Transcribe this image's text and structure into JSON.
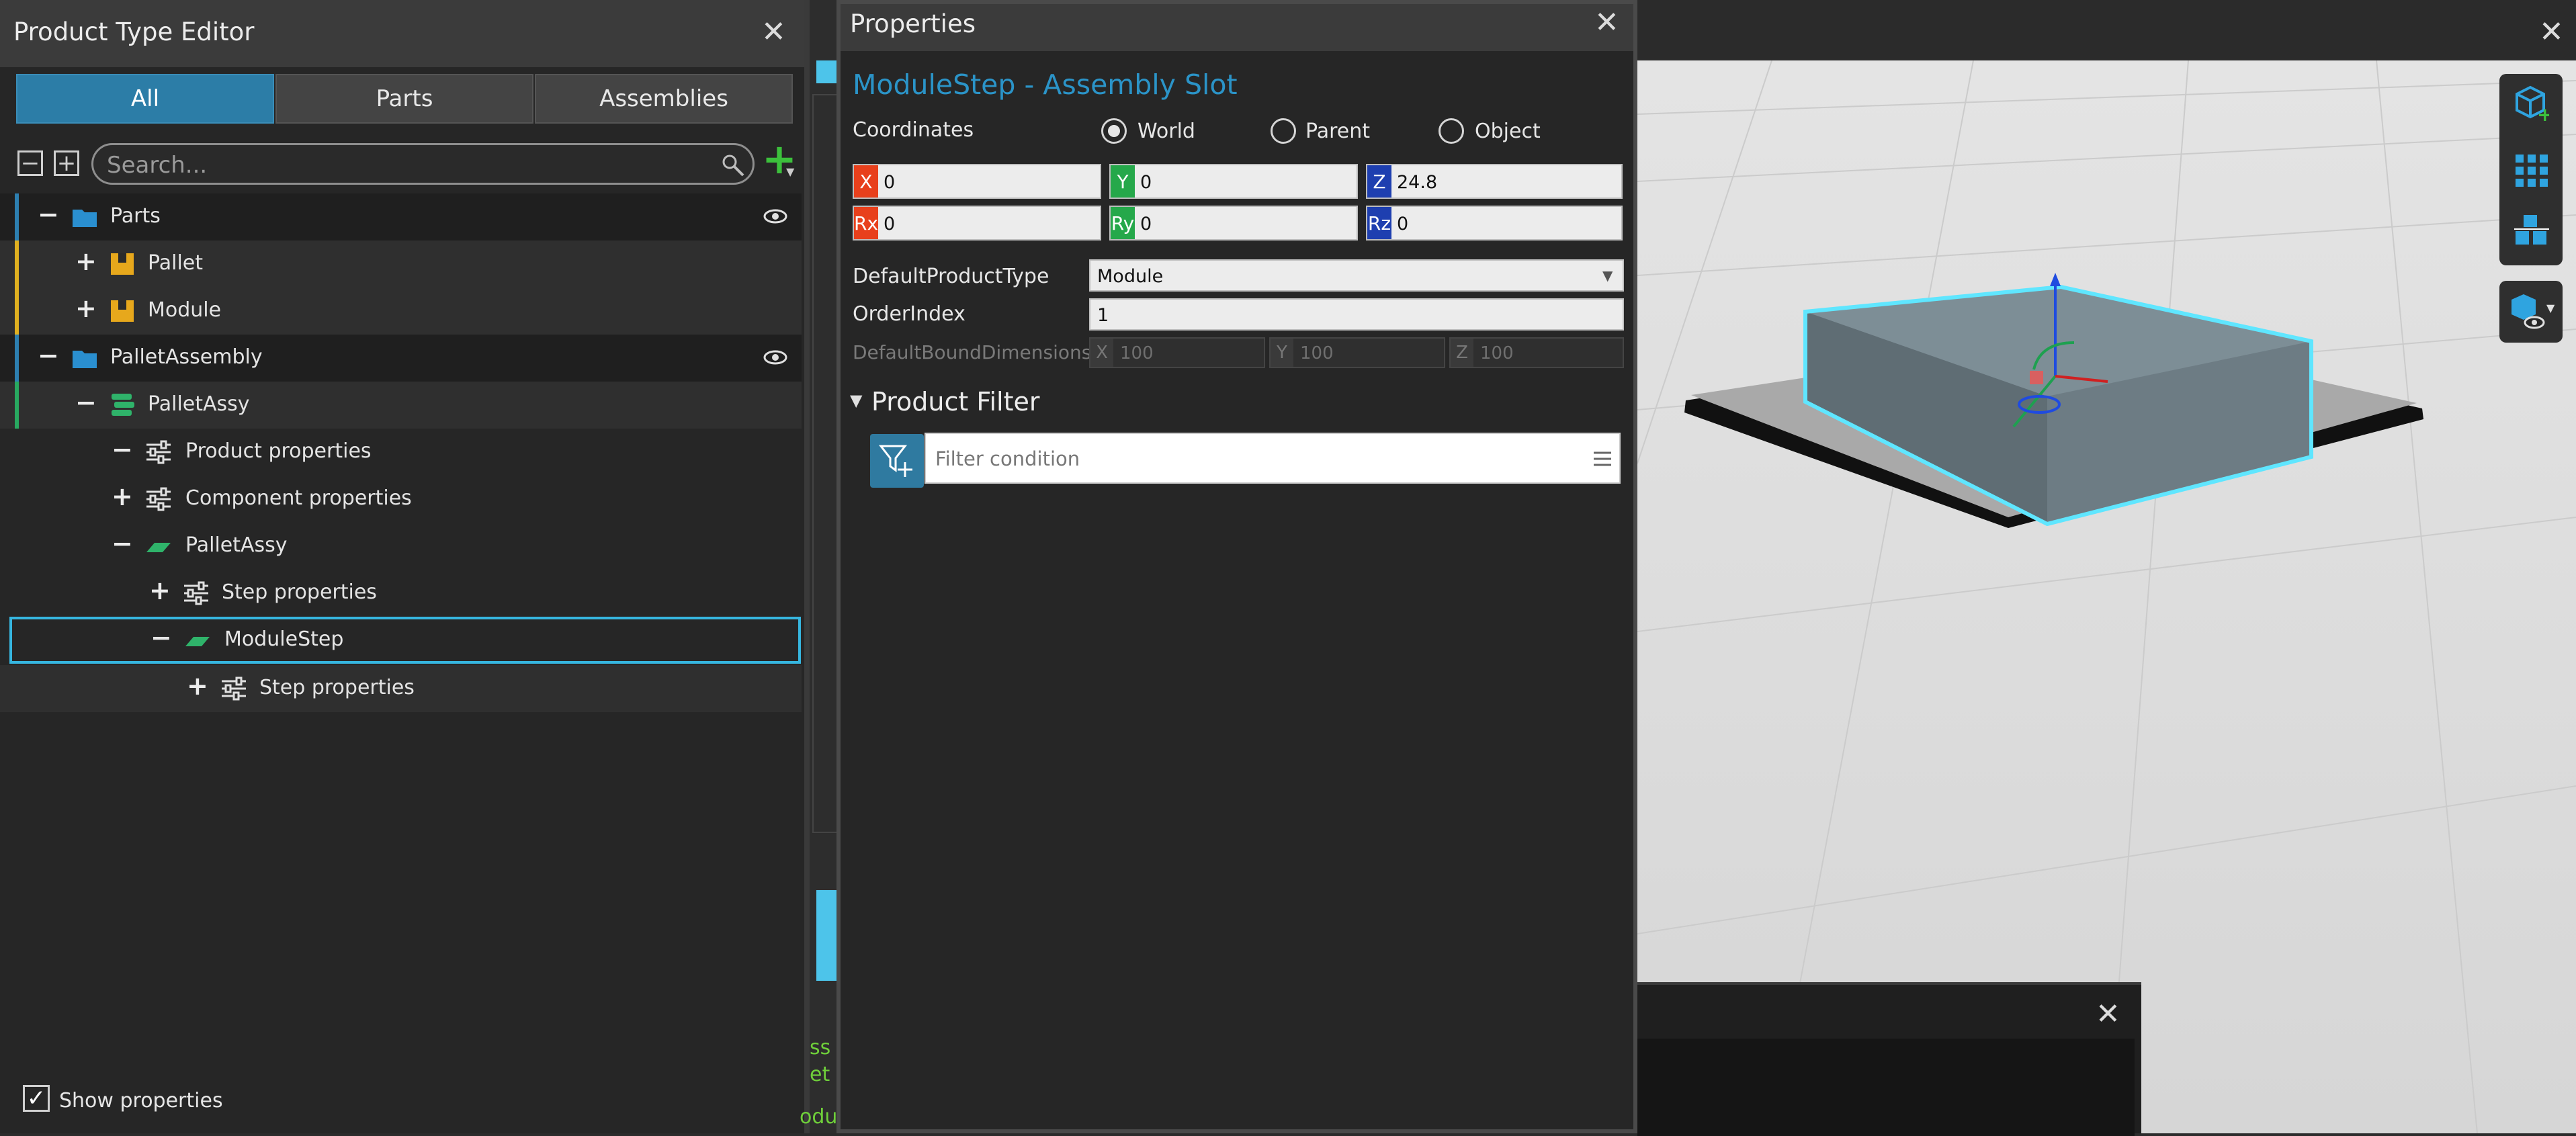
{
  "product_type_editor": {
    "title": "Product Type Editor",
    "tabs": [
      {
        "label": "All",
        "active": true
      },
      {
        "label": "Parts",
        "active": false
      },
      {
        "label": "Assemblies",
        "active": false
      }
    ],
    "collapse_all_symbol": "−",
    "expand_all_symbol": "+",
    "search_placeholder": "Search...",
    "add_symbol": "+",
    "tree": {
      "parts": {
        "toggle": "−",
        "label": "Parts"
      },
      "pallet": {
        "toggle": "+",
        "label": "Pallet"
      },
      "module": {
        "toggle": "+",
        "label": "Module"
      },
      "pallet_assembly": {
        "toggle": "−",
        "label": "PalletAssembly"
      },
      "pallet_assy_root": {
        "toggle": "−",
        "label": "PalletAssy"
      },
      "product_properties": {
        "toggle": "−",
        "label": "Product properties"
      },
      "component_properties": {
        "toggle": "+",
        "label": "Component properties"
      },
      "pallet_assy_step": {
        "toggle": "−",
        "label": "PalletAssy"
      },
      "step_properties_1": {
        "toggle": "+",
        "label": "Step properties"
      },
      "module_step": {
        "toggle": "−",
        "label": "ModuleStep"
      },
      "step_properties_2": {
        "toggle": "+",
        "label": "Step properties"
      }
    },
    "show_properties": {
      "label": "Show properties",
      "checked": true
    }
  },
  "properties": {
    "title": "Properties",
    "heading": "ModuleStep - Assembly Slot",
    "coordinates_label": "Coordinates",
    "radio_options": [
      {
        "label": "World",
        "selected": true
      },
      {
        "label": "Parent",
        "selected": false
      },
      {
        "label": "Object",
        "selected": false
      }
    ],
    "coords": {
      "x": {
        "tag": "X",
        "value": "0"
      },
      "y": {
        "tag": "Y",
        "value": "0"
      },
      "z": {
        "tag": "Z",
        "value": "24.8"
      },
      "rx": {
        "tag": "Rx",
        "value": "0"
      },
      "ry": {
        "tag": "Ry",
        "value": "0"
      },
      "rz": {
        "tag": "Rz",
        "value": "0"
      }
    },
    "default_product_type": {
      "label": "DefaultProductType",
      "value": "Module"
    },
    "order_index": {
      "label": "OrderIndex",
      "value": "1"
    },
    "default_bound_dimensions": {
      "label": "DefaultBoundDimensions",
      "x": {
        "tag": "X",
        "value": "100"
      },
      "y": {
        "tag": "Y",
        "value": "100"
      },
      "z": {
        "tag": "Z",
        "value": "100"
      }
    },
    "product_filter": {
      "label": "Product Filter",
      "placeholder": "Filter condition"
    }
  },
  "output": {
    "lines": [
      "ss",
      "et",
      "oduct.Components"
    ]
  },
  "colors": {
    "accent_blue": "#2c7da7",
    "selection_cyan": "#36b6e0",
    "x_red": "#e8401c",
    "y_green": "#25a84a",
    "z_blue": "#1e3fb0",
    "output_green": "#6fcf3a"
  }
}
